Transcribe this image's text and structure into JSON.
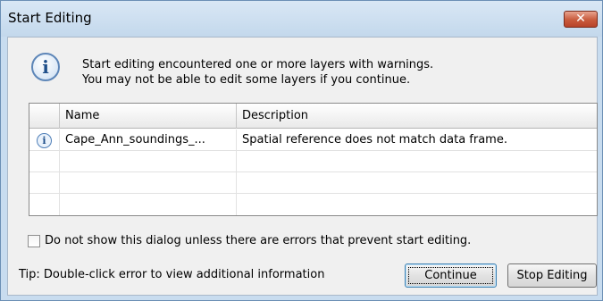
{
  "window": {
    "title": "Start Editing",
    "close_glyph": "✕"
  },
  "message": {
    "line1": "Start editing encountered one or more layers with warnings.",
    "line2": "You may not be able to edit some layers if you continue.",
    "icon": "info-icon"
  },
  "grid": {
    "columns": [
      "",
      "Name",
      "Description"
    ],
    "rows": [
      {
        "icon": "info-icon",
        "name": "Cape_Ann_soundings_...",
        "description": "Spatial reference does not match data frame."
      },
      {
        "icon": "",
        "name": "",
        "description": ""
      },
      {
        "icon": "",
        "name": "",
        "description": ""
      },
      {
        "icon": "",
        "name": "",
        "description": ""
      }
    ]
  },
  "checkbox": {
    "label": "Do not show this dialog unless there are errors that prevent start editing.",
    "checked": false
  },
  "tip": "Tip: Double-click error to view additional information",
  "buttons": {
    "continue": "Continue",
    "stop": "Stop Editing"
  }
}
